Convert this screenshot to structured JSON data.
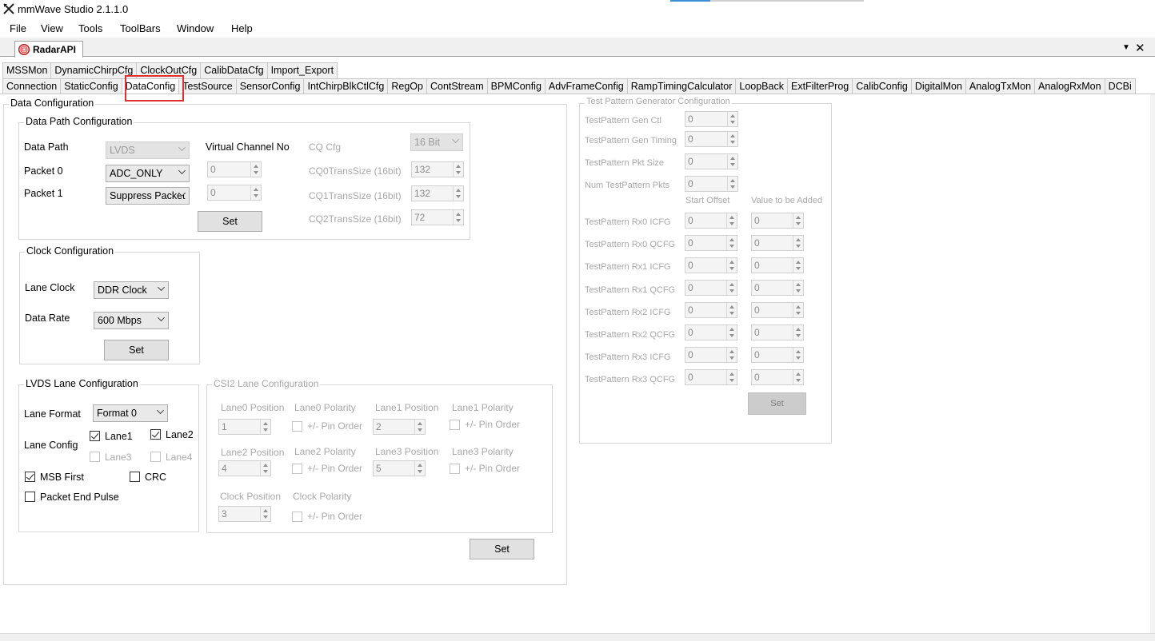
{
  "window": {
    "title": "mmWave Studio 2.1.1.0"
  },
  "menu": [
    "File",
    "View",
    "Tools",
    "ToolBars",
    "Window",
    "Help"
  ],
  "doc_tab": {
    "label": "RadarAPI",
    "dropdown": "▼",
    "close": "✕"
  },
  "tabs_row1": [
    "MSSMon",
    "DynamicChirpCfg",
    "ClockOutCfg",
    "CalibDataCfg",
    "Import_Export"
  ],
  "tabs_row2": [
    "Connection",
    "StaticConfig",
    "DataConfig",
    "TestSource",
    "SensorConfig",
    "IntChirpBlkCtlCfg",
    "RegOp",
    "ContStream",
    "BPMConfig",
    "AdvFrameConfig",
    "RampTimingCalculator",
    "LoopBack",
    "ExtFilterProg",
    "CalibConfig",
    "DigitalMon",
    "AnalogTxMon",
    "AnalogRxMon",
    "DCBi"
  ],
  "active_tab": "DataConfig",
  "data_configuration": {
    "title": "Data Configuration",
    "data_path": {
      "title": "Data Path Configuration",
      "data_path_label": "Data Path",
      "data_path_value": "LVDS",
      "packet0_label": "Packet 0",
      "packet0_value": "ADC_ONLY",
      "packet1_label": "Packet 1",
      "packet1_value": "Suppress Packet",
      "vc_label": "Virtual Channel No",
      "vc0": "0",
      "vc1": "0",
      "set": "Set",
      "cq_cfg_label": "CQ Cfg",
      "cq_cfg_value": "16 Bit",
      "cq0_label": "CQ0TransSize (16bit)",
      "cq0_value": "132",
      "cq1_label": "CQ1TransSize (16bit)",
      "cq1_value": "132",
      "cq2_label": "CQ2TransSize (16bit)",
      "cq2_value": "72"
    },
    "clock": {
      "title": "Clock Configuration",
      "lane_clock_label": "Lane Clock",
      "lane_clock_value": "DDR Clock",
      "data_rate_label": "Data Rate",
      "data_rate_value": "600 Mbps",
      "set": "Set"
    },
    "lvds": {
      "title": "LVDS Lane Configuration",
      "lane_format_label": "Lane Format",
      "lane_format_value": "Format 0",
      "lane_config_label": "Lane Config",
      "lane1": "Lane1",
      "lane1_checked": true,
      "lane2": "Lane2",
      "lane2_checked": true,
      "lane3": "Lane3",
      "lane3_checked": false,
      "lane4": "Lane4",
      "lane4_checked": false,
      "msb_first": "MSB First",
      "msb_first_checked": true,
      "crc": "CRC",
      "crc_checked": false,
      "packet_end_pulse": "Packet End Pulse",
      "packet_end_pulse_checked": false
    },
    "csi2": {
      "title": "CSI2 Lane Configuration",
      "lane0_position": "Lane0 Position",
      "lane0_value": "1",
      "lane0_polarity": "Lane0 Polarity",
      "lane1_position": "Lane1 Position",
      "lane1_value": "2",
      "lane1_polarity": "Lane1 Polarity",
      "lane2_position": "Lane2 Position",
      "lane2_value": "4",
      "lane2_polarity": "Lane2 Polarity",
      "lane3_position": "Lane3 Position",
      "lane3_value": "5",
      "lane3_polarity": "Lane3 Polarity",
      "clock_position": "Clock Position",
      "clock_value": "3",
      "clock_polarity": "Clock Polarity",
      "pin_order": "+/- Pin Order"
    },
    "set": "Set"
  },
  "test_pattern": {
    "title": "Test Pattern Generator Configuration",
    "gen_ctl_label": "TestPattern Gen Ctl",
    "gen_ctl": "0",
    "gen_timing_label": "TestPattern Gen Timing",
    "gen_timing": "0",
    "pkt_size_label": "TestPattern Pkt Size",
    "pkt_size": "0",
    "num_pkts_label": "Num TestPattern Pkts",
    "num_pkts": "0",
    "start_offset_header": "Start Offset",
    "value_added_header": "Value to be Added",
    "rows": [
      {
        "label": "TestPattern Rx0 ICFG",
        "offset": "0",
        "add": "0"
      },
      {
        "label": "TestPattern Rx0 QCFG",
        "offset": "0",
        "add": "0"
      },
      {
        "label": "TestPattern Rx1 ICFG",
        "offset": "0",
        "add": "0"
      },
      {
        "label": "TestPattern Rx1 QCFG",
        "offset": "0",
        "add": "0"
      },
      {
        "label": "TestPattern Rx2 ICFG",
        "offset": "0",
        "add": "0"
      },
      {
        "label": "TestPattern Rx2 QCFG",
        "offset": "0",
        "add": "0"
      },
      {
        "label": "TestPattern Rx3 ICFG",
        "offset": "0",
        "add": "0"
      },
      {
        "label": "TestPattern Rx3 QCFG",
        "offset": "0",
        "add": "0"
      }
    ],
    "set": "Set"
  }
}
